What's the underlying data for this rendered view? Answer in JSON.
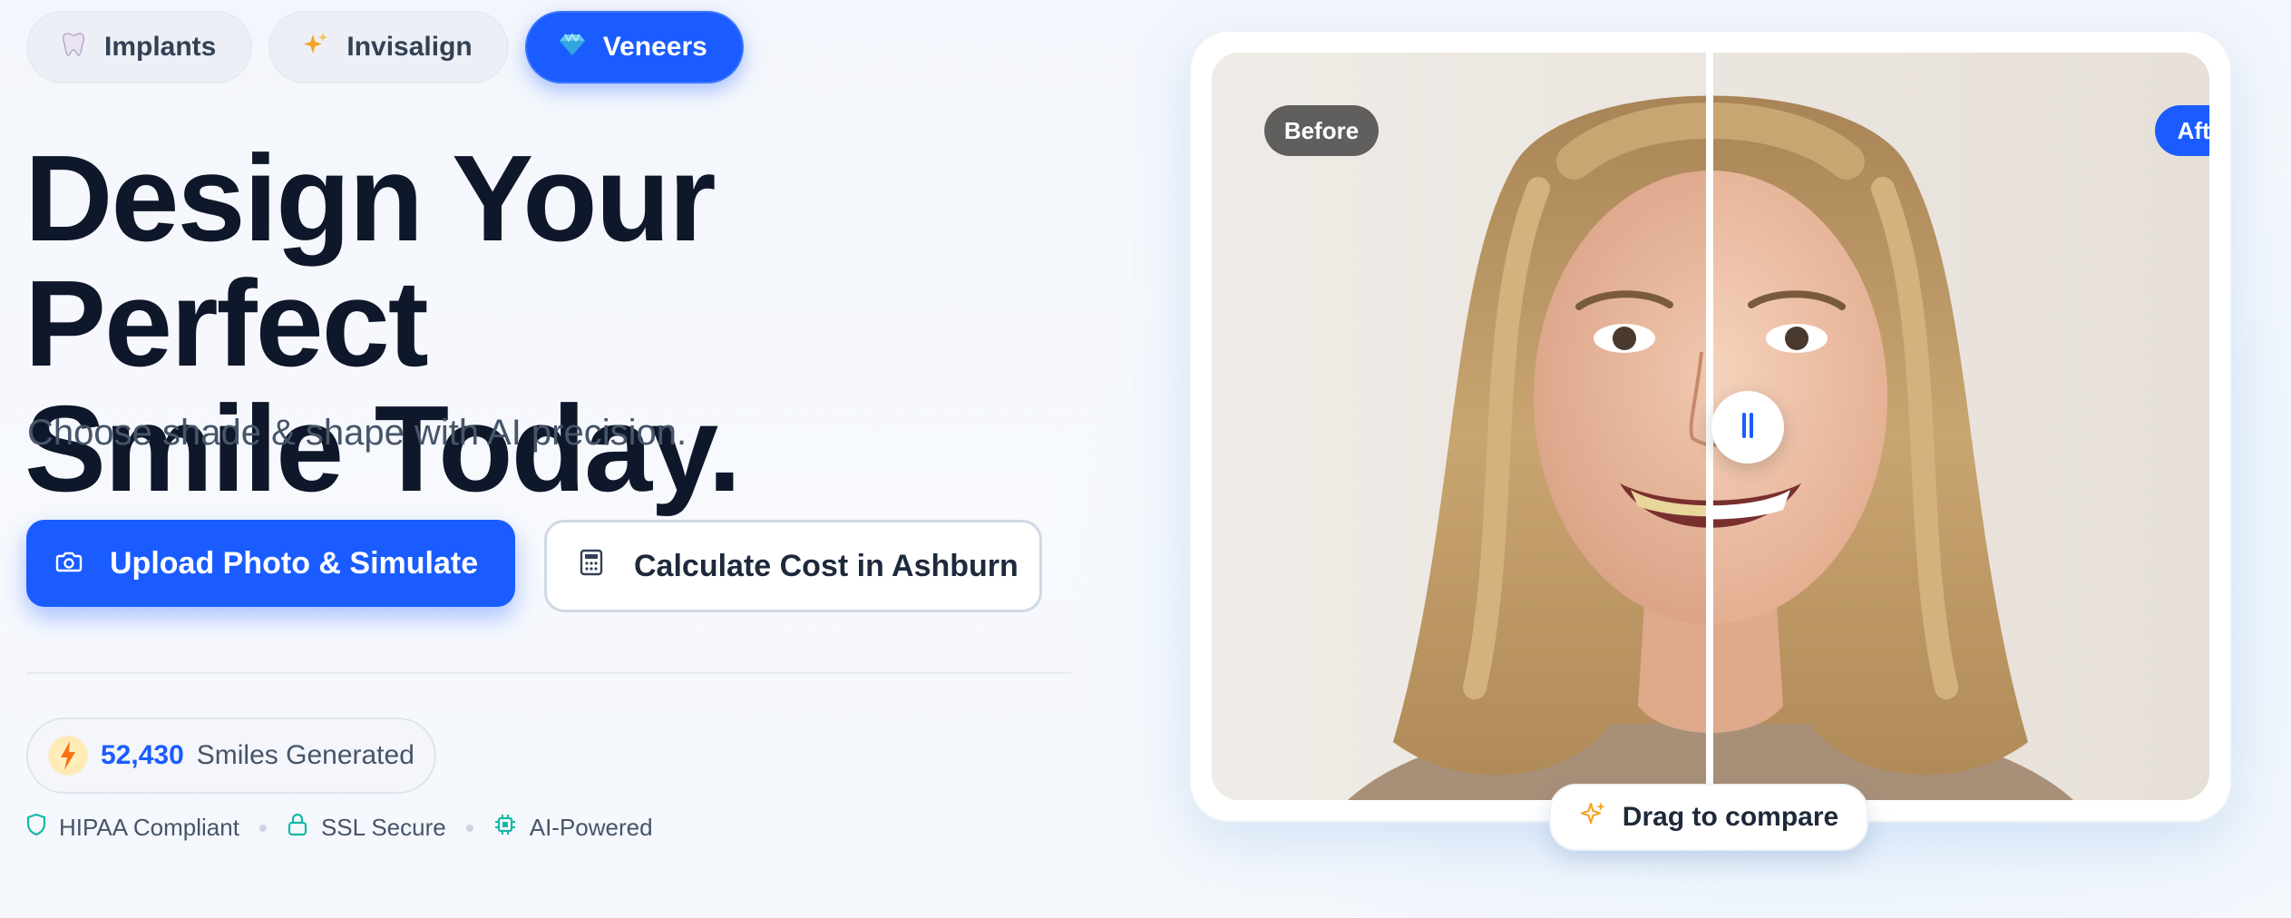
{
  "tabs": [
    {
      "label": "Implants",
      "icon": "tooth-icon",
      "active": false
    },
    {
      "label": "Invisalign",
      "icon": "sparkles-icon",
      "active": false
    },
    {
      "label": "Veneers",
      "icon": "gem-icon",
      "active": true
    }
  ],
  "hero": {
    "headline_line1": "Design Your Perfect",
    "headline_line2": "Smile Today.",
    "subhead": "Choose shade & shape with AI precision."
  },
  "buttons": {
    "primary": {
      "label": "Upload Photo & Simulate",
      "icon": "camera-icon"
    },
    "secondary": {
      "label": "Calculate Cost in Ashburn",
      "icon": "calculator-icon"
    }
  },
  "stats": {
    "count": "52,430",
    "label": "Smiles Generated",
    "icon": "bolt-icon"
  },
  "trust": [
    {
      "label": "HIPAA Compliant",
      "icon": "shield-icon"
    },
    {
      "label": "SSL Secure",
      "icon": "lock-icon"
    },
    {
      "label": "AI-Powered",
      "icon": "chip-icon"
    }
  ],
  "compare": {
    "before_label": "Before",
    "after_label": "After",
    "drag_hint": "Drag to compare",
    "slider_position": 0.5
  },
  "colors": {
    "accent": "#1a5cff",
    "headline": "#0f172a",
    "muted": "#475569",
    "trust_icon": "#14b8a6"
  }
}
